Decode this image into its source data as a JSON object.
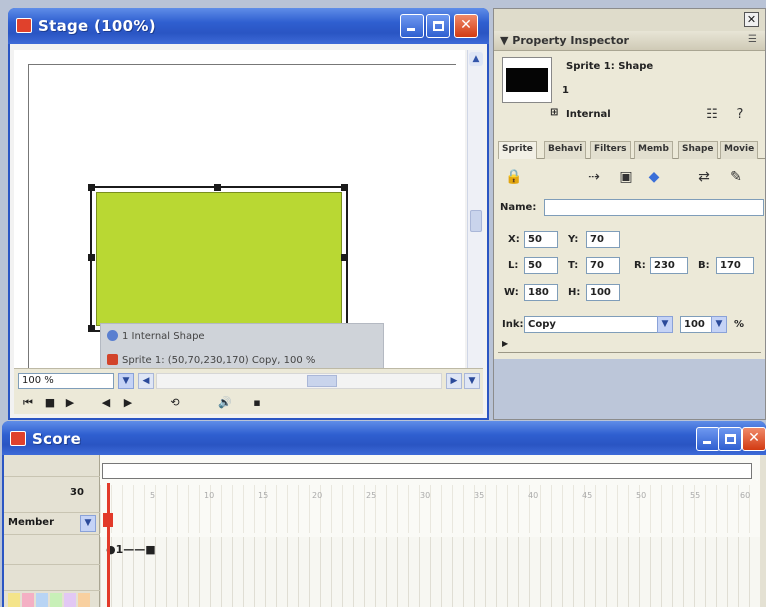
{
  "stage": {
    "title": "Stage (100%)",
    "zoom_value": "100 %",
    "overlay": {
      "line1": "1 Internal Shape",
      "line2": "Sprite 1: (50,70,230,170) Copy, 100 %"
    },
    "controls": {
      "rewind": "⏮",
      "stop": "■",
      "play": "▶",
      "step_back": "◀",
      "step_forward": "▶",
      "loop": "⟲",
      "volume": "🔊",
      "camera": "▪"
    }
  },
  "property_inspector": {
    "header": "Property Inspector",
    "sprite_name": "Sprite 1: Shape",
    "sprite_number": "1",
    "cast_lib": "Internal",
    "tabs": [
      "Sprite",
      "Behavi",
      "Filters",
      "Memb",
      "Shape",
      "Movie"
    ],
    "name_label": "Name:",
    "name_value": "",
    "x_label": "X:",
    "x_value": "50",
    "y_label": "Y:",
    "y_value": "70",
    "l_label": "L:",
    "l_value": "50",
    "t_label": "T:",
    "t_value": "70",
    "r_label": "R:",
    "r_value": "230",
    "b_label": "B:",
    "b_value": "170",
    "w_label": "W:",
    "w_value": "180",
    "h_label": "H:",
    "h_value": "100",
    "ink_label": "Ink:",
    "ink_value": "Copy",
    "blend_value": "100",
    "percent": "%"
  },
  "score": {
    "title": "Score",
    "member_label": "Member",
    "frame_marker": "30",
    "sprite_span": "●1——■",
    "tick_labels": [
      "5",
      "10",
      "15",
      "20",
      "25",
      "30",
      "35",
      "40",
      "45",
      "50",
      "55",
      "60"
    ]
  },
  "colors": {
    "sprite_fill": "#b9d833",
    "title_bar": "#2a55c3",
    "playhead": "#e23a2a"
  }
}
